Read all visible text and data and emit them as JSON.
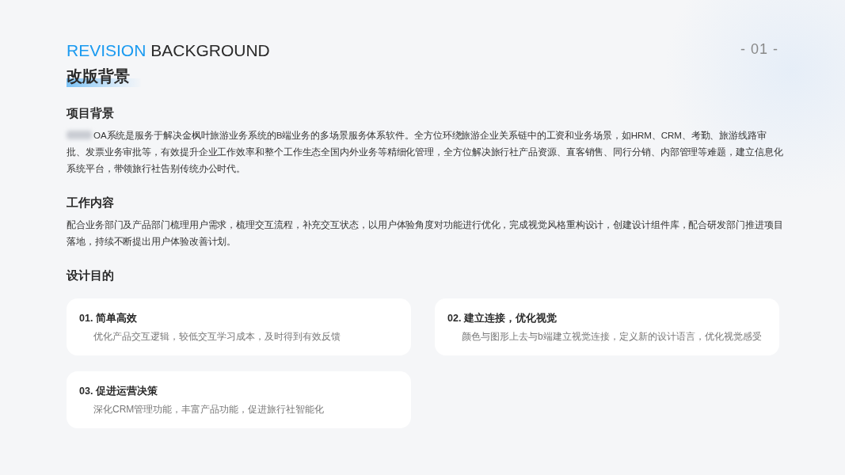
{
  "header": {
    "title_accent": "REVISION",
    "title_rest": "BACKGROUND",
    "subtitle": "改版背景",
    "page_number": "- 01 -"
  },
  "sections": [
    {
      "heading": "项目背景",
      "redacted_prefix": true,
      "body": "OA系统是服务于解决金枫叶旅游业务系统的B端业务的多场景服务体系软件。全方位环绕旅游企业关系链中的工资和业务场景，如HRM、CRM、考勤、旅游线路审批、发票业务审批等，有效提升企业工作效率和整个工作生态全国内外业务等精细化管理，全方位解决旅行社产品资源、直客销售、同行分销、内部管理等难题，建立信息化系统平台，带领旅行社告别传统办公时代。"
    },
    {
      "heading": "工作内容",
      "body": "配合业务部门及产品部门梳理用户需求，梳理交互流程，补充交互状态，以用户体验角度对功能进行优化，完成视觉风格重构设计，创建设计组件库，配合研发部门推进项目落地，持续不断提出用户体验改善计划。"
    },
    {
      "heading": "设计目的"
    }
  ],
  "goals": [
    {
      "title": "01. 简单高效",
      "text": "优化产品交互逻辑，较低交互学习成本，及时得到有效反馈"
    },
    {
      "title": "02. 建立连接，优化视觉",
      "text": "颜色与图形上去与b端建立视觉连接，定义新的设计语言，优化视觉感受"
    },
    {
      "title": "03. 促进运营决策",
      "text": "深化CRM管理功能，丰富产品功能，促进旅行社智能化"
    }
  ]
}
